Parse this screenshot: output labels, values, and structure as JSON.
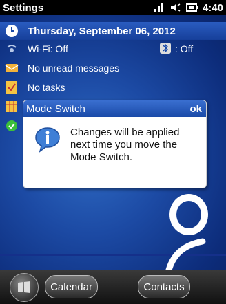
{
  "window": {
    "title": "Settings",
    "time": "4:40"
  },
  "status_icons": [
    "signal-icon",
    "speaker-icon",
    "battery-icon"
  ],
  "today": {
    "date": "Thursday, September 06, 2012",
    "wifi": "Wi-Fi: Off",
    "bluetooth": ": Off",
    "messages": "No unread messages",
    "tasks": "No tasks"
  },
  "dialog": {
    "title": "Mode Switch",
    "ok_label": "ok",
    "message": "Changes will be applied next time you move the Mode Switch."
  },
  "softkeys": {
    "left": "Calendar",
    "right": "Contacts"
  },
  "colors": {
    "accent": "#1a4aa8",
    "titlebar": "#000000"
  }
}
